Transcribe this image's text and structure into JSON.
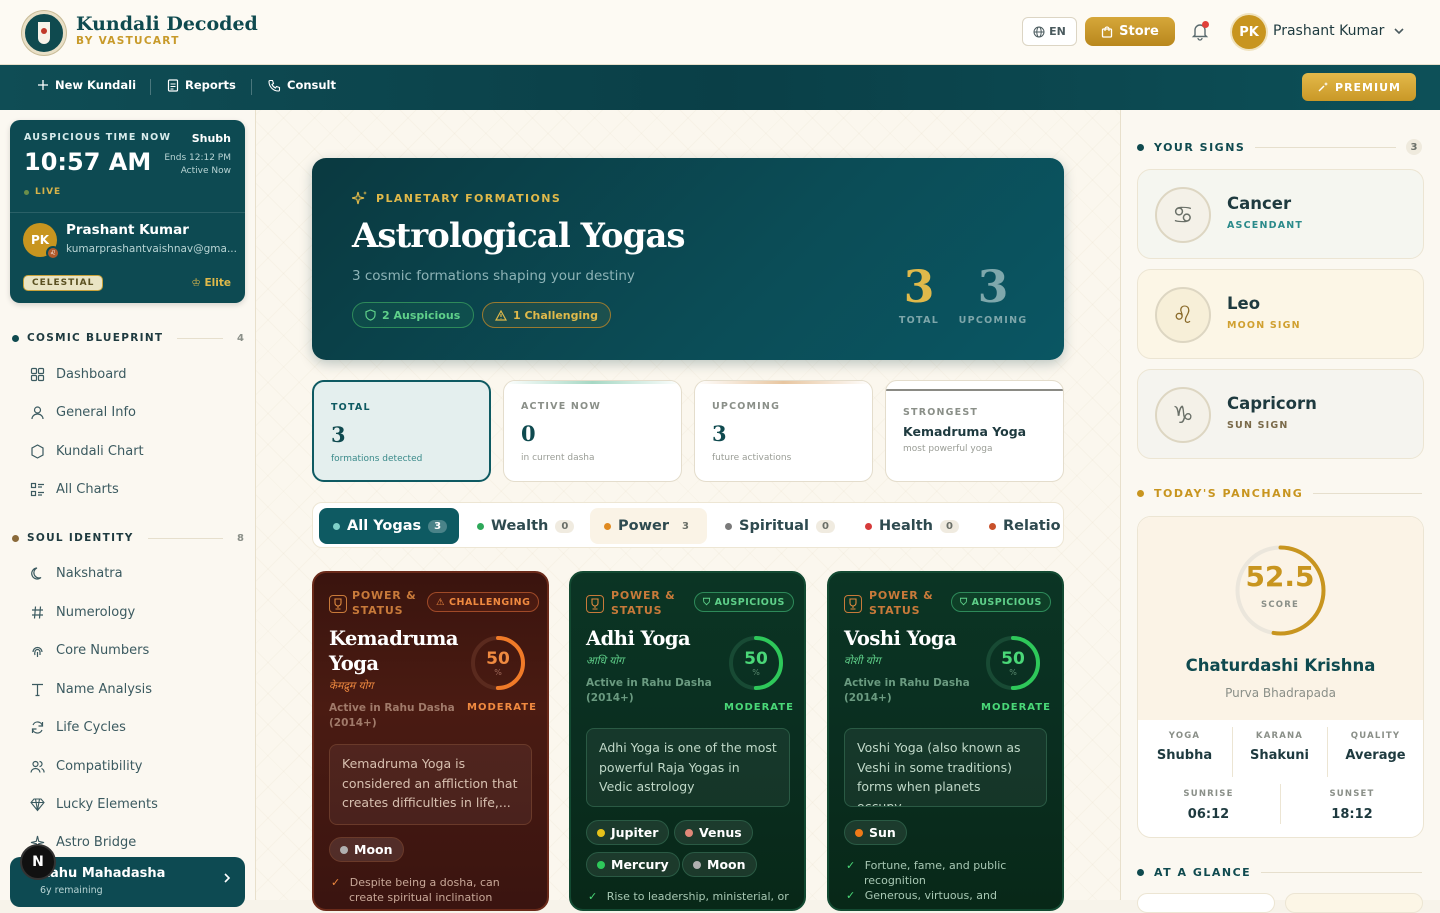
{
  "header": {
    "brand": "Kundali Decoded",
    "brand_sub": "BY VASTUCART",
    "lang": "EN",
    "store_label": "Store",
    "user_initials": "PK",
    "user_name": "Prashant Kumar"
  },
  "nav": {
    "items": [
      "New Kundali",
      "Reports",
      "Consult"
    ],
    "premium_label": "PREMIUM"
  },
  "timecard": {
    "label": "AUSPICIOUS TIME NOW",
    "muhurta": "Shubh",
    "time": "10:57 AM",
    "ends": "Ends 12:12 PM",
    "status": "Active Now",
    "live": "LIVE",
    "initials": "PK",
    "name": "Prashant Kumar",
    "email": "kumarprashantvaishnav@gma...",
    "tier": "CELESTIAL",
    "elite": "Elite"
  },
  "sidebar": {
    "section1": {
      "title": "COSMIC BLUEPRINT",
      "count": "4",
      "items": [
        "Dashboard",
        "General Info",
        "Kundali Chart",
        "All Charts"
      ]
    },
    "section2": {
      "title": "SOUL IDENTITY",
      "count": "8",
      "items": [
        "Nakshatra",
        "Numerology",
        "Core Numbers",
        "Name Analysis",
        "Life Cycles",
        "Compatibility",
        "Lucky Elements",
        "Astro Bridge"
      ]
    },
    "dasha": {
      "title": "Rahu Mahadasha",
      "sub": "6y remaining"
    },
    "n_badge": "N"
  },
  "hero": {
    "eyebrow": "PLANETARY FORMATIONS",
    "title": "Astrological Yogas",
    "subtitle": "3 cosmic formations shaping your destiny",
    "pill_auspicious": "2 Auspicious",
    "pill_challenging": "1 Challenging",
    "total_value": "3",
    "total_label": "TOTAL",
    "upcoming_value": "3",
    "upcoming_label": "UPCOMING"
  },
  "stats": [
    {
      "label": "TOTAL",
      "value": "3",
      "sub": "formations detected"
    },
    {
      "label": "ACTIVE NOW",
      "value": "0",
      "sub": "in current dasha"
    },
    {
      "label": "UPCOMING",
      "value": "3",
      "sub": "future activations"
    },
    {
      "label": "STRONGEST",
      "value": "Kemadruma Yoga",
      "sub": "most powerful yoga"
    }
  ],
  "tabs": [
    {
      "label": "All Yogas",
      "count": "3",
      "color": "#7fd0c8"
    },
    {
      "label": "Wealth",
      "count": "0",
      "color": "#2ea85a"
    },
    {
      "label": "Power",
      "count": "3",
      "color": "#e08a20"
    },
    {
      "label": "Spiritual",
      "count": "0",
      "color": "#7a7a7a"
    },
    {
      "label": "Health",
      "count": "0",
      "color": "#d63a3a"
    },
    {
      "label": "Relatio",
      "count": "",
      "color": "#c8502a"
    }
  ],
  "cards": [
    {
      "category": [
        "POWER &",
        "STATUS"
      ],
      "badge": "CHALLENGING",
      "title": [
        "Kemadruma",
        "Yoga"
      ],
      "hindi": "केमद्रुम योग",
      "active": [
        "Active in Rahu Dasha",
        "(2014+)"
      ],
      "score": "50",
      "score_fraction": 0.5,
      "pct": "%",
      "level": "MODERATE",
      "desc": "Kemadruma Yoga is considered an affliction that creates difficulties in life,...",
      "planets": [
        {
          "name": "Moon",
          "color": "#b0b0b0"
        }
      ],
      "points": [
        "Despite being a dosha, can",
        "create spiritual inclination"
      ]
    },
    {
      "category": [
        "POWER &",
        "STATUS"
      ],
      "badge": "AUSPICIOUS",
      "title": [
        "Adhi Yoga"
      ],
      "hindi": "आधि योग",
      "active": [
        "Active in Rahu Dasha",
        "(2014+)"
      ],
      "score": "50",
      "score_fraction": 0.5,
      "pct": "%",
      "level": "MODERATE",
      "desc": "Adhi Yoga is one of the most powerful Raja Yogas in Vedic astrology",
      "planets": [
        {
          "name": "Jupiter",
          "color": "#e6c21a"
        },
        {
          "name": "Venus",
          "color": "#e08878"
        },
        {
          "name": "Mercury",
          "color": "#2ec85a"
        },
        {
          "name": "Moon",
          "color": "#b0b0b0"
        }
      ],
      "points": [
        "Rise to leadership, ministerial, or"
      ]
    },
    {
      "category": [
        "POWER &",
        "STATUS"
      ],
      "badge": "AUSPICIOUS",
      "title": [
        "Voshi Yoga"
      ],
      "hindi": "वोशी योग",
      "active": [
        "Active in Rahu Dasha",
        "(2014+)"
      ],
      "score": "50",
      "score_fraction": 0.5,
      "pct": "%",
      "level": "MODERATE",
      "desc": "Voshi Yoga (also known as Veshi in some traditions) forms when planets occupy...",
      "planets": [
        {
          "name": "Sun",
          "color": "#f07a18"
        }
      ],
      "points": [
        "Fortune, fame, and public",
        "recognition",
        "Generous, virtuous, and"
      ]
    }
  ],
  "right": {
    "signs_title": "YOUR SIGNS",
    "signs_count": "3",
    "signs": [
      {
        "name": "Cancer",
        "role": "ASCENDANT",
        "icon": "crab-icon"
      },
      {
        "name": "Leo",
        "role": "MOON SIGN",
        "icon": "lion-icon"
      },
      {
        "name": "Capricorn",
        "role": "SUN SIGN",
        "icon": "goat-icon"
      }
    ],
    "panchang_title": "TODAY'S PANCHANG",
    "panchang": {
      "score": "52.5",
      "score_fraction": 0.525,
      "score_label": "SCORE",
      "tithi": "Chaturdashi Krishna",
      "nakshatra": "Purva Bhadrapada",
      "yoga_label": "YOGA",
      "yoga": "Shubha",
      "karana_label": "KARANA",
      "karana": "Shakuni",
      "quality_label": "QUALITY",
      "quality": "Average",
      "sunrise_label": "SUNRISE",
      "sunrise": "06:12",
      "sunset_label": "SUNSET",
      "sunset": "18:12"
    },
    "glance_title": "AT A GLANCE"
  },
  "colors": {
    "teal": "#0f4a4f",
    "gold": "#c8951f",
    "auspicious": "#2ec85a",
    "challenging": "#f07a28"
  }
}
